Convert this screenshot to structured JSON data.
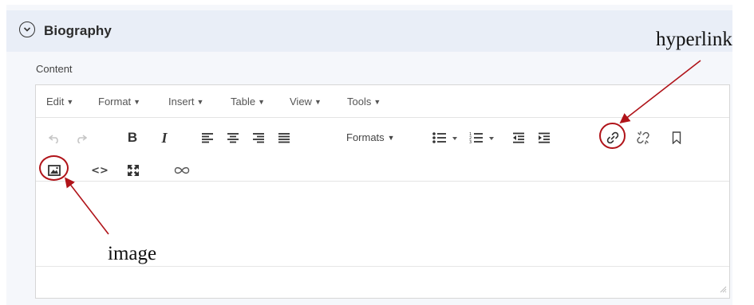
{
  "section": {
    "title": "Biography"
  },
  "field": {
    "label": "Content"
  },
  "menubar": [
    {
      "label": "Edit"
    },
    {
      "label": "Format"
    },
    {
      "label": "Insert"
    },
    {
      "label": "Table"
    },
    {
      "label": "View"
    },
    {
      "label": "Tools"
    }
  ],
  "toolbar": {
    "formats_label": "Formats",
    "icons": [
      "undo-icon",
      "redo-icon",
      "bold-icon",
      "italic-icon",
      "align-left-icon",
      "align-center-icon",
      "align-right-icon",
      "align-justify-icon",
      "bullet-list-icon",
      "numbered-list-icon",
      "outdent-icon",
      "indent-icon",
      "link-icon",
      "unlink-icon",
      "bookmark-icon",
      "image-icon",
      "code-icon",
      "fullscreen-icon",
      "infinity-icon"
    ]
  },
  "annotations": {
    "hyperlink": "hyperlink",
    "image": "image",
    "color": "#b01319"
  }
}
